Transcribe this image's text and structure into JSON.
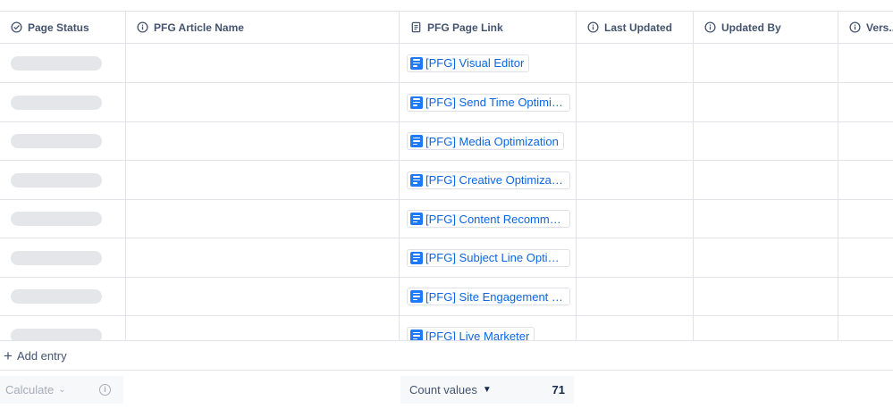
{
  "columns": [
    {
      "label": "Page Status",
      "icon": "status-check-icon"
    },
    {
      "label": "PFG Article Name",
      "icon": "info-icon"
    },
    {
      "label": "PFG Page Link",
      "icon": "document-icon"
    },
    {
      "label": "Last Updated",
      "icon": "info-icon"
    },
    {
      "label": "Updated By",
      "icon": "info-icon"
    },
    {
      "label": "Vers...",
      "icon": "info-icon"
    }
  ],
  "rows": [
    {
      "page_link": "[PFG] Visual Editor"
    },
    {
      "page_link": "[PFG] Send Time Optimiz..."
    },
    {
      "page_link": "[PFG] Media Optimization"
    },
    {
      "page_link": "[PFG] Creative Optimizati..."
    },
    {
      "page_link": "[PFG] Content Recomme..."
    },
    {
      "page_link": "[PFG] Subject Line Optimi..."
    },
    {
      "page_link": "[PFG] Site Engagement S..."
    },
    {
      "page_link": "[PFG] Live Marketer"
    }
  ],
  "add_entry": {
    "label": "Add entry"
  },
  "footer": {
    "calculate_label": "Calculate",
    "count_label": "Count values",
    "count_value": "71"
  },
  "colors": {
    "link": "#0c66e4",
    "doc_icon": "#1d7afc",
    "skeleton": "#e4e6ea",
    "border": "#e1e3e8"
  }
}
